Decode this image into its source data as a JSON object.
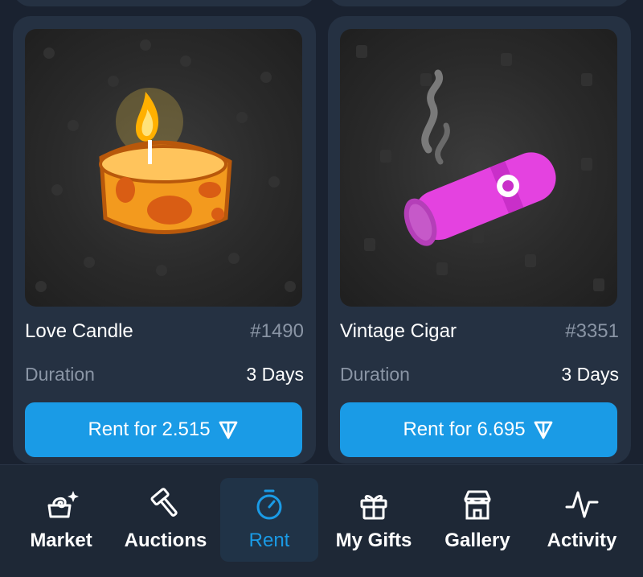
{
  "cards": [
    {
      "name": "Love Candle",
      "number": "#1490",
      "duration_label": "Duration",
      "duration_value": "3 Days",
      "rent_label": "Rent for 2.515",
      "currency_icon": "ton-icon"
    },
    {
      "name": "Vintage Cigar",
      "number": "#3351",
      "duration_label": "Duration",
      "duration_value": "3 Days",
      "rent_label": "Rent for 6.695",
      "currency_icon": "ton-icon"
    }
  ],
  "nav": {
    "items": [
      {
        "label": "Market",
        "icon": "market-icon"
      },
      {
        "label": "Auctions",
        "icon": "hammer-icon"
      },
      {
        "label": "Rent",
        "icon": "stopwatch-icon",
        "active": true
      },
      {
        "label": "My Gifts",
        "icon": "gift-icon"
      },
      {
        "label": "Gallery",
        "icon": "store-icon"
      },
      {
        "label": "Activity",
        "icon": "activity-icon"
      }
    ]
  },
  "colors": {
    "accent": "#1a9be6",
    "background": "#1a2230",
    "card": "#253142",
    "muted_text": "#8a95a5"
  }
}
